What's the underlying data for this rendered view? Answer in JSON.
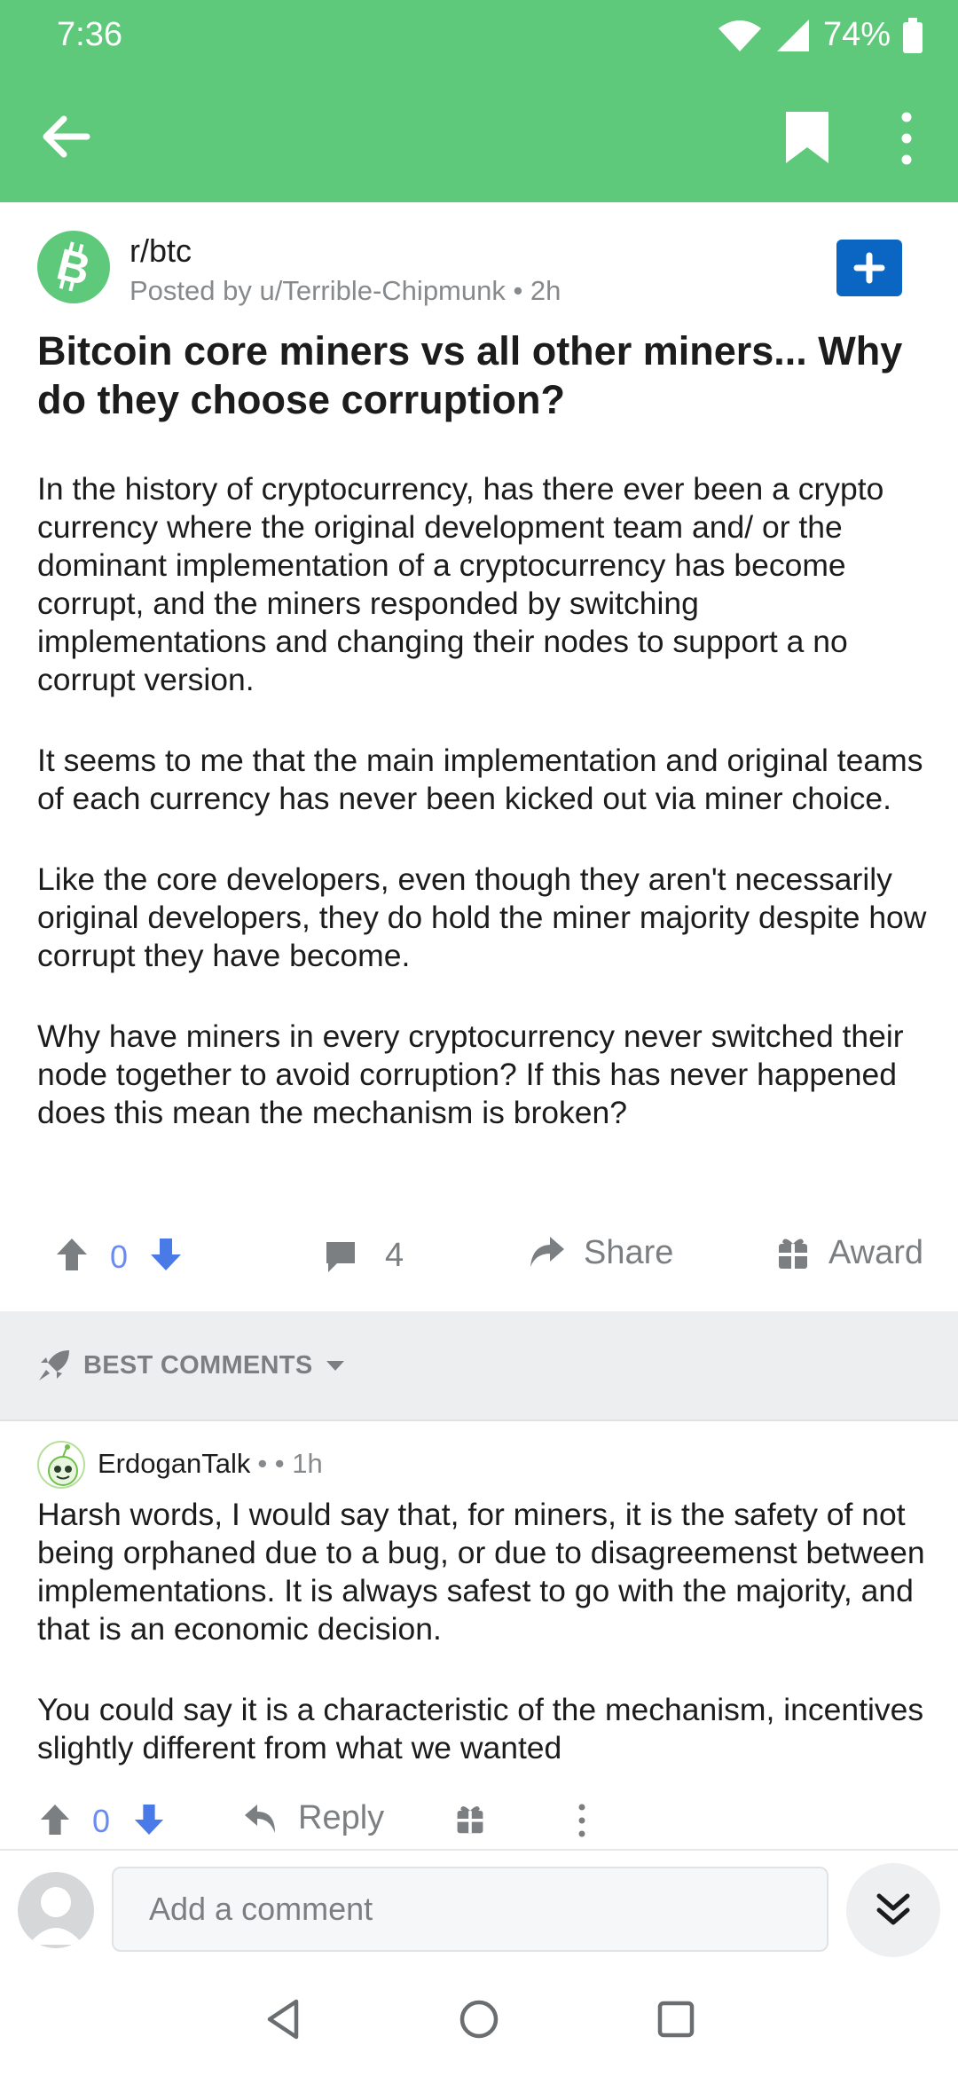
{
  "status_bar": {
    "time": "7:36",
    "battery": "74%",
    "icons": [
      "wifi-icon",
      "signal-icon",
      "battery-icon"
    ]
  },
  "app_bar": {
    "icons": [
      "back-arrow-icon",
      "bookmark-icon",
      "more-vertical-icon"
    ]
  },
  "post": {
    "subreddit": "r/btc",
    "meta": "Posted by u/Terrible-Chipmunk • 2h",
    "title": "Bitcoin core miners vs all other miners... Why do they choose corruption?",
    "paragraphs": [
      "In the history of cryptocurrency, has there ever been a crypto currency where the original development team and/ or the dominant implementation of a cryptocurrency has become corrupt, and the miners responded by switching implementations and changing their nodes to support a  no corrupt version.",
      "It seems to me that the main implementation and original teams of each currency has never been kicked out via miner choice.",
      "Like the core developers, even though they aren't necessarily original developers, they do hold the miner majority despite how corrupt they have become.",
      "Why have miners in every cryptocurrency never switched their node together to avoid corruption?  If this has never happened does this mean the mechanism is broken?"
    ],
    "score": "0",
    "comments_count": "4",
    "share_label": "Share",
    "award_label": "Award"
  },
  "sort": {
    "label": "BEST COMMENTS"
  },
  "comment": {
    "author": "ErdoganTalk",
    "dots": "•  • 1h",
    "paragraphs": [
      "Harsh words, I would say that, for miners, it is the safety of not being orphaned due to a bug, or due to disagreemenst between implementations. It is always safest to go with the majority, and that is an economic decision.",
      "You could say it is a characteristic of the mechanism, incentives slightly different from what we wanted"
    ],
    "score": "0",
    "reply_label": "Reply"
  },
  "composer": {
    "placeholder": "Add a comment"
  },
  "colors": {
    "app_bar": "#5ec97a",
    "upvote": "#7c7f82",
    "downvote": "#4a7ae8",
    "join_button": "#0a66c2"
  }
}
